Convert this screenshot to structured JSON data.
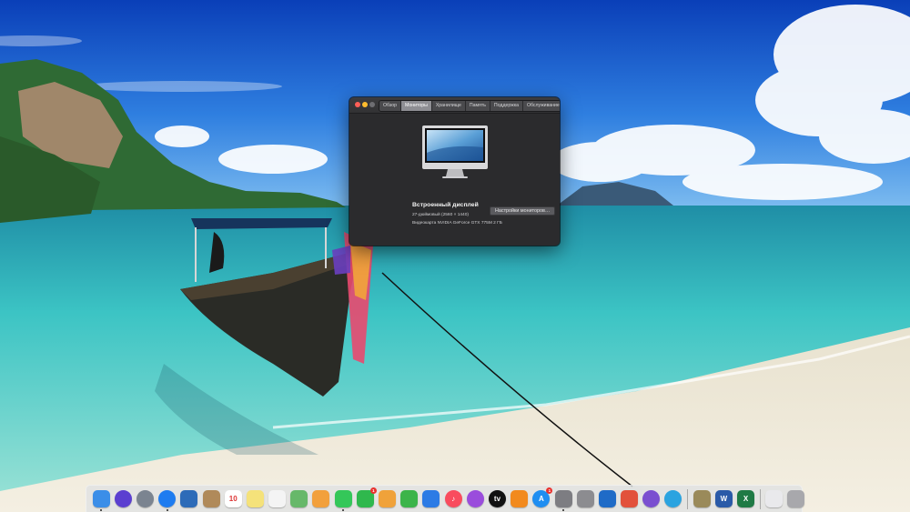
{
  "window": {
    "tabs": [
      {
        "label": "Обзор",
        "active": false
      },
      {
        "label": "Мониторы",
        "active": true
      },
      {
        "label": "Хранилище",
        "active": false
      },
      {
        "label": "Память",
        "active": false
      },
      {
        "label": "Поддержка",
        "active": false
      },
      {
        "label": "Обслуживание",
        "active": false
      }
    ],
    "display_name": "Встроенный дисплей",
    "display_resolution": "27-дюймовый (2560 × 1440)",
    "display_gpu": "Видеокарта NVIDIA GeForce GTX 775M 2 ГБ",
    "settings_button": "Настройки мониторов…"
  },
  "dock": {
    "items": [
      {
        "name": "finder-icon",
        "glyph": "",
        "bg": "#3b8ee8",
        "running": true,
        "badge": ""
      },
      {
        "name": "siri-icon",
        "glyph": "",
        "bg": "#5b3fd0",
        "running": false,
        "badge": ""
      },
      {
        "name": "launchpad-icon",
        "glyph": "",
        "bg": "#7b8490",
        "running": false,
        "badge": ""
      },
      {
        "name": "safari-icon",
        "glyph": "",
        "bg": "#1e7cf0",
        "running": true,
        "badge": ""
      },
      {
        "name": "photo-slideshow-icon",
        "glyph": "",
        "bg": "#2d6bb8",
        "running": false,
        "badge": ""
      },
      {
        "name": "contacts-icon",
        "glyph": "",
        "bg": "#b08a5a",
        "running": false,
        "badge": ""
      },
      {
        "name": "calendar-icon",
        "glyph": "10",
        "bg": "#ffffff",
        "running": false,
        "badge": ""
      },
      {
        "name": "notes-icon",
        "glyph": "",
        "bg": "#f5e27a",
        "running": false,
        "badge": ""
      },
      {
        "name": "reminders-icon",
        "glyph": "",
        "bg": "#f4f4f4",
        "running": false,
        "badge": ""
      },
      {
        "name": "maps-icon",
        "glyph": "",
        "bg": "#67b86a",
        "running": false,
        "badge": ""
      },
      {
        "name": "photos-icon",
        "glyph": "",
        "bg": "#f2a03c",
        "running": false,
        "badge": ""
      },
      {
        "name": "messages-icon",
        "glyph": "",
        "bg": "#34c759",
        "running": true,
        "badge": ""
      },
      {
        "name": "facetime-icon",
        "glyph": "",
        "bg": "#2fb84d",
        "running": false,
        "badge": "1"
      },
      {
        "name": "pages-icon",
        "glyph": "",
        "bg": "#f0a23a",
        "running": false,
        "badge": ""
      },
      {
        "name": "numbers-icon",
        "glyph": "",
        "bg": "#3cb44a",
        "running": false,
        "badge": ""
      },
      {
        "name": "keynote-icon",
        "glyph": "",
        "bg": "#2c7be5",
        "running": false,
        "badge": ""
      },
      {
        "name": "music-icon",
        "glyph": "♪",
        "bg": "#f94c5e",
        "running": false,
        "badge": ""
      },
      {
        "name": "podcasts-icon",
        "glyph": "",
        "bg": "#9a4ddc",
        "running": false,
        "badge": ""
      },
      {
        "name": "apple-tv-icon",
        "glyph": "tv",
        "bg": "#111111",
        "running": false,
        "badge": ""
      },
      {
        "name": "books-icon",
        "glyph": "",
        "bg": "#f28a1e",
        "running": false,
        "badge": ""
      },
      {
        "name": "app-store-icon",
        "glyph": "A",
        "bg": "#1f8ef1",
        "running": false,
        "badge": "1"
      },
      {
        "name": "system-preferences-icon",
        "glyph": "",
        "bg": "#7d7d82",
        "running": true,
        "badge": ""
      },
      {
        "name": "disk-utility-icon",
        "glyph": "",
        "bg": "#8c8c90",
        "running": false,
        "badge": ""
      },
      {
        "name": "trello-icon",
        "glyph": "",
        "bg": "#1f6bc7",
        "running": false,
        "badge": ""
      },
      {
        "name": "utility-red-icon",
        "glyph": "",
        "bg": "#e2513c",
        "running": false,
        "badge": ""
      },
      {
        "name": "viber-icon",
        "glyph": "",
        "bg": "#7a4fd0",
        "running": false,
        "badge": ""
      },
      {
        "name": "telegram-icon",
        "glyph": "",
        "bg": "#2aa3e0",
        "running": false,
        "badge": ""
      },
      {
        "name": "preview-icon",
        "glyph": "",
        "bg": "#9a8a5a",
        "running": false,
        "badge": ""
      },
      {
        "name": "word-icon",
        "glyph": "W",
        "bg": "#2a5aa8",
        "running": false,
        "badge": ""
      },
      {
        "name": "excel-icon",
        "glyph": "X",
        "bg": "#1f7a45",
        "running": false,
        "badge": ""
      },
      {
        "name": "document-stack-icon",
        "glyph": "",
        "bg": "#e9e9ec",
        "running": false,
        "badge": ""
      },
      {
        "name": "trash-icon",
        "glyph": "",
        "bg": "#a8a8ac",
        "running": false,
        "badge": ""
      }
    ],
    "separators_after": [
      "telegram-icon",
      "excel-icon"
    ]
  }
}
